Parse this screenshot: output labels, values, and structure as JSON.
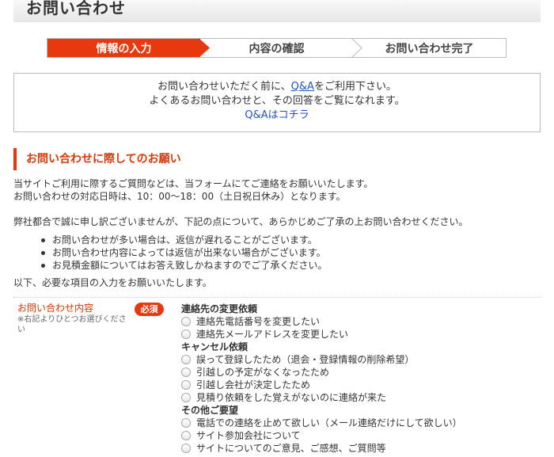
{
  "page": {
    "title": "お問い合わせ"
  },
  "steps": [
    {
      "label": "情報の入力",
      "active": true
    },
    {
      "label": "内容の確認",
      "active": false
    },
    {
      "label": "お問い合わせ完了",
      "active": false
    }
  ],
  "qa_box": {
    "line1_prefix": "お問い合わせいただく前に、",
    "line1_link": "Q&A",
    "line1_suffix": "をご利用下さい。",
    "line2": "よくあるお問い合わせと、その回答をご覧になれます。",
    "link": "Q&Aはコチラ"
  },
  "notice": {
    "heading": "お問い合わせに際してのお願い",
    "intro1": "当サイトご利用に際するご質問などは、当フォームにてご連絡をお願いいたします。",
    "intro2": "お問い合わせの対応日時は、10：00〜18：00（土日祝日休み）となります。",
    "intro3": "弊社都合で誠に申し訳ございませんが、下記の点について、あらかじめご了承の上お問い合わせください。",
    "bullets": [
      "お問い合わせが多い場合は、返信が遅れることがございます。",
      "お問い合わせ内容によっては返信が出来ない場合がございます。",
      "お見積金額についてはお答え致しかねますのでご了承ください。"
    ],
    "outro": "以下、必要な項目の入力をお願いいたします。"
  },
  "form": {
    "field_label": "お問い合わせ内容",
    "field_hint": "※右記よりひとつお選びください",
    "required": "必須",
    "groups": [
      {
        "title": "連絡先の変更依頼",
        "options": [
          "連絡先電話番号を変更したい",
          "連絡先メールアドレスを変更したい"
        ]
      },
      {
        "title": "キャンセル依頼",
        "options": [
          "誤って登録したため（退会・登録情報の削除希望）",
          "引越しの予定がなくなったため",
          "引越し会社が決定したため",
          "見積り依頼をした覚えがないのに連絡が来た"
        ]
      },
      {
        "title": "その他ご要望",
        "options": [
          "電話での連絡を止めて欲しい（メール連絡だけにして欲しい）",
          "サイト参加会社について",
          "サイトについてのご意見、ご感想、ご質問等"
        ]
      }
    ]
  },
  "colors": {
    "accent": "#e8380d",
    "link": "#2255bb"
  }
}
